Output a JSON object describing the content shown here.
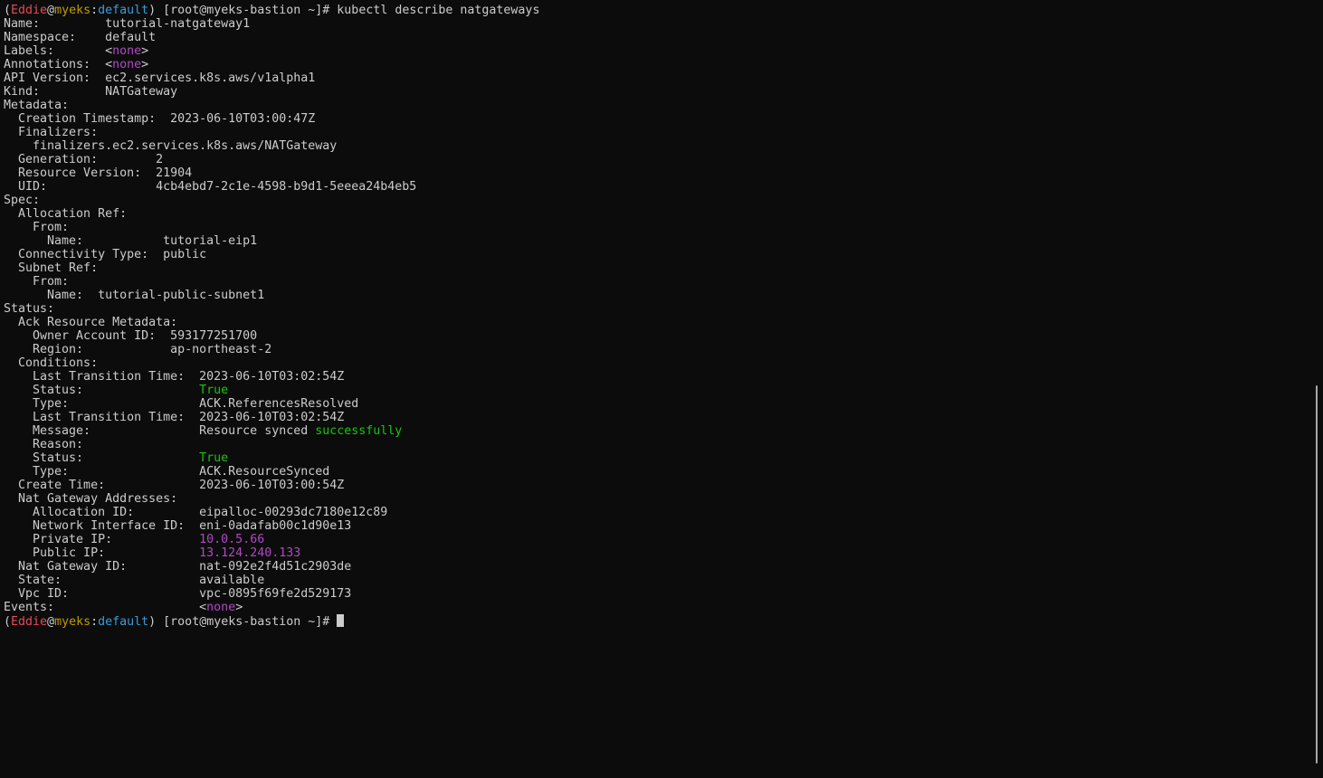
{
  "colors": {
    "background": "#0c0c0c",
    "text": "#cccccc",
    "user": "#e74856",
    "host": "#c19c00",
    "context": "#3b9bd9",
    "none": "#b148c6",
    "true": "#16c60c",
    "ip": "#b148c6"
  },
  "terminal": {
    "lines": [
      [
        {
          "t": "("
        },
        {
          "t": "Eddie",
          "c": "user"
        },
        {
          "t": "@"
        },
        {
          "t": "myeks",
          "c": "host"
        },
        {
          "t": ":"
        },
        {
          "t": "default",
          "c": "context"
        },
        {
          "t": ") [root@myeks-bastion ~]# kubectl describe natgateways"
        }
      ],
      [
        {
          "t": "Name:         tutorial-natgateway1"
        }
      ],
      [
        {
          "t": "Namespace:    default"
        }
      ],
      [
        {
          "t": "Labels:       <"
        },
        {
          "t": "none",
          "c": "none"
        },
        {
          "t": ">"
        }
      ],
      [
        {
          "t": "Annotations:  <"
        },
        {
          "t": "none",
          "c": "none"
        },
        {
          "t": ">"
        }
      ],
      [
        {
          "t": "API Version:  ec2.services.k8s.aws/v1alpha1"
        }
      ],
      [
        {
          "t": "Kind:         NATGateway"
        }
      ],
      [
        {
          "t": "Metadata:"
        }
      ],
      [
        {
          "t": "  Creation Timestamp:  2023-06-10T03:00:47Z"
        }
      ],
      [
        {
          "t": "  Finalizers:"
        }
      ],
      [
        {
          "t": "    finalizers.ec2.services.k8s.aws/NATGateway"
        }
      ],
      [
        {
          "t": "  Generation:        2"
        }
      ],
      [
        {
          "t": "  Resource Version:  21904"
        }
      ],
      [
        {
          "t": "  UID:               4cb4ebd7-2c1e-4598-b9d1-5eeea24b4eb5"
        }
      ],
      [
        {
          "t": "Spec:"
        }
      ],
      [
        {
          "t": "  Allocation Ref:"
        }
      ],
      [
        {
          "t": "    From:"
        }
      ],
      [
        {
          "t": "      Name:           tutorial-eip1"
        }
      ],
      [
        {
          "t": "  Connectivity Type:  public"
        }
      ],
      [
        {
          "t": "  Subnet Ref:"
        }
      ],
      [
        {
          "t": "    From:"
        }
      ],
      [
        {
          "t": "      Name:  tutorial-public-subnet1"
        }
      ],
      [
        {
          "t": "Status:"
        }
      ],
      [
        {
          "t": "  Ack Resource Metadata:"
        }
      ],
      [
        {
          "t": "    Owner Account ID:  593177251700"
        }
      ],
      [
        {
          "t": "    Region:            ap-northeast-2"
        }
      ],
      [
        {
          "t": "  Conditions:"
        }
      ],
      [
        {
          "t": "    Last Transition Time:  2023-06-10T03:02:54Z"
        }
      ],
      [
        {
          "t": "    Status:                "
        },
        {
          "t": "True",
          "c": "true"
        }
      ],
      [
        {
          "t": "    Type:                  ACK.ReferencesResolved"
        }
      ],
      [
        {
          "t": "    Last Transition Time:  2023-06-10T03:02:54Z"
        }
      ],
      [
        {
          "t": "    Message:               Resource synced "
        },
        {
          "t": "successfully",
          "c": "true"
        }
      ],
      [
        {
          "t": "    Reason:"
        }
      ],
      [
        {
          "t": "    Status:                "
        },
        {
          "t": "True",
          "c": "true"
        }
      ],
      [
        {
          "t": "    Type:                  ACK.ResourceSynced"
        }
      ],
      [
        {
          "t": "  Create Time:             2023-06-10T03:00:54Z"
        }
      ],
      [
        {
          "t": "  Nat Gateway Addresses:"
        }
      ],
      [
        {
          "t": "    Allocation ID:         eipalloc-00293dc7180e12c89"
        }
      ],
      [
        {
          "t": "    Network Interface ID:  eni-0adafab00c1d90e13"
        }
      ],
      [
        {
          "t": "    Private IP:            "
        },
        {
          "t": "10.0.5.66",
          "c": "ip"
        }
      ],
      [
        {
          "t": "    Public IP:             "
        },
        {
          "t": "13.124.240.133",
          "c": "ip"
        }
      ],
      [
        {
          "t": "  Nat Gateway ID:          nat-092e2f4d51c2903de"
        }
      ],
      [
        {
          "t": "  State:                   available"
        }
      ],
      [
        {
          "t": "  Vpc ID:                  vpc-0895f69fe2d529173"
        }
      ],
      [
        {
          "t": "Events:                    <"
        },
        {
          "t": "none",
          "c": "none"
        },
        {
          "t": ">"
        }
      ],
      [
        {
          "t": "("
        },
        {
          "t": "Eddie",
          "c": "user"
        },
        {
          "t": "@"
        },
        {
          "t": "myeks",
          "c": "host"
        },
        {
          "t": ":"
        },
        {
          "t": "default",
          "c": "context"
        },
        {
          "t": ") [root@myeks-bastion ~]# "
        }
      ]
    ]
  }
}
